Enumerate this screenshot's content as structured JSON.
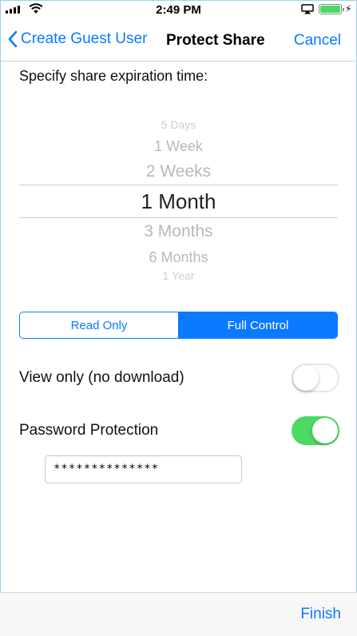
{
  "status_bar": {
    "time": "2:49 PM"
  },
  "nav": {
    "back_label": "Create Guest User",
    "title": "Protect Share",
    "cancel_label": "Cancel"
  },
  "expiration": {
    "prompt": "Specify share expiration time:",
    "options": [
      "5 Days",
      "1 Week",
      "2 Weeks",
      "1 Month",
      "3 Months",
      "6 Months",
      "1 Year"
    ],
    "selected": "1 Month"
  },
  "access_mode": {
    "options": [
      "Read Only",
      "Full Control"
    ],
    "selected": "Full Control"
  },
  "view_only": {
    "label": "View only (no download)",
    "enabled": false
  },
  "password_protection": {
    "label": "Password Protection",
    "enabled": true,
    "value": "**************"
  },
  "toolbar": {
    "finish_label": "Finish"
  },
  "colors": {
    "accent": "#0a7aff",
    "toggle_on": "#4cd964",
    "battery": "#4cd964"
  }
}
